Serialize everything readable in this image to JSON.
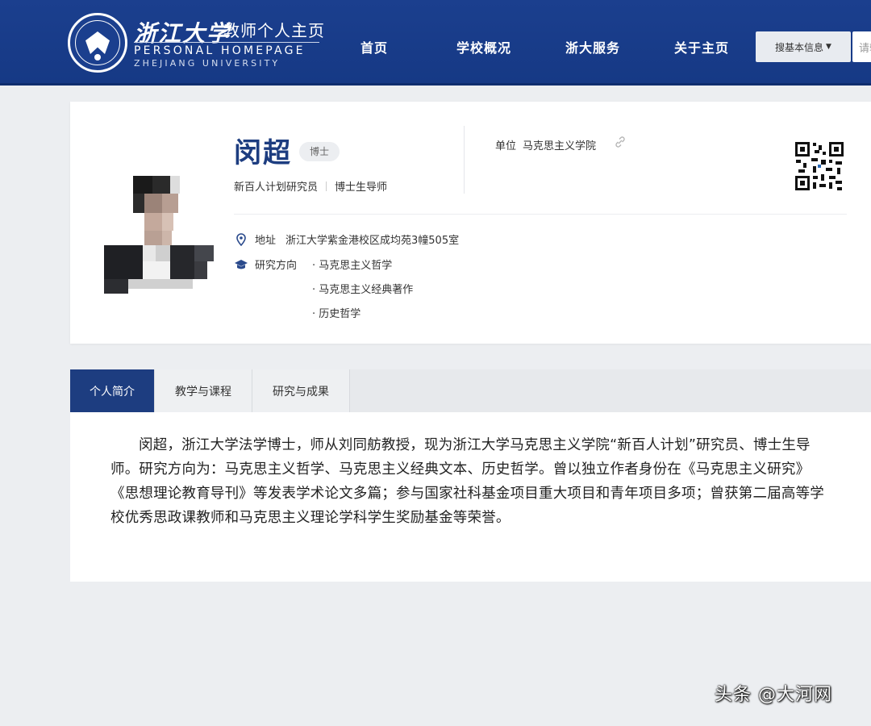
{
  "header": {
    "brand_calligraphy": "浙江大学",
    "brand_cn": "教师个人主页",
    "brand_en_line1": "PERSONAL HOMEPAGE",
    "brand_en_line2": "ZHEJIANG UNIVERSITY",
    "emblem_text": "ZHEJIANG UNIVERSITY",
    "nav": [
      "首页",
      "学校概况",
      "浙大服务",
      "关于主页"
    ],
    "search_select": "搜基本信息",
    "search_placeholder": "请输入"
  },
  "profile": {
    "name": "闵超",
    "degree": "博士",
    "titles": [
      "新百人计划研究员",
      "博士生导师"
    ],
    "unit_label": "单位",
    "unit_value": "马克思主义学院",
    "address_label": "地址",
    "address_value": "浙江大学紫金港校区成均苑3幢505室",
    "research_label": "研究方向",
    "research_items": [
      "· 马克思主义哲学",
      "· 马克思主义经典著作",
      "· 历史哲学"
    ]
  },
  "tabs": [
    {
      "label": "个人简介",
      "active": true
    },
    {
      "label": "教学与课程",
      "active": false
    },
    {
      "label": "研究与成果",
      "active": false
    }
  ],
  "bio": "闵超，浙江大学法学博士，师从刘同舫教授，现为浙江大学马克思主义学院“新百人计划”研究员、博士生导师。研究方向为：马克思主义哲学、马克思主义经典文本、历史哲学。曾以独立作者身份在《马克思主义研究》《思想理论教育导刊》等发表学术论文多篇；参与国家社科基金项目重大项目和青年项目多项；曾获第二届高等学校优秀思政课教师和马克思主义理论学科学生奖励基金等荣誉。",
  "watermark": "头条 @大河网",
  "colors": {
    "header_bg": "#1b3f8e",
    "accent": "#1d3d80",
    "page_bg": "#eceef1"
  }
}
